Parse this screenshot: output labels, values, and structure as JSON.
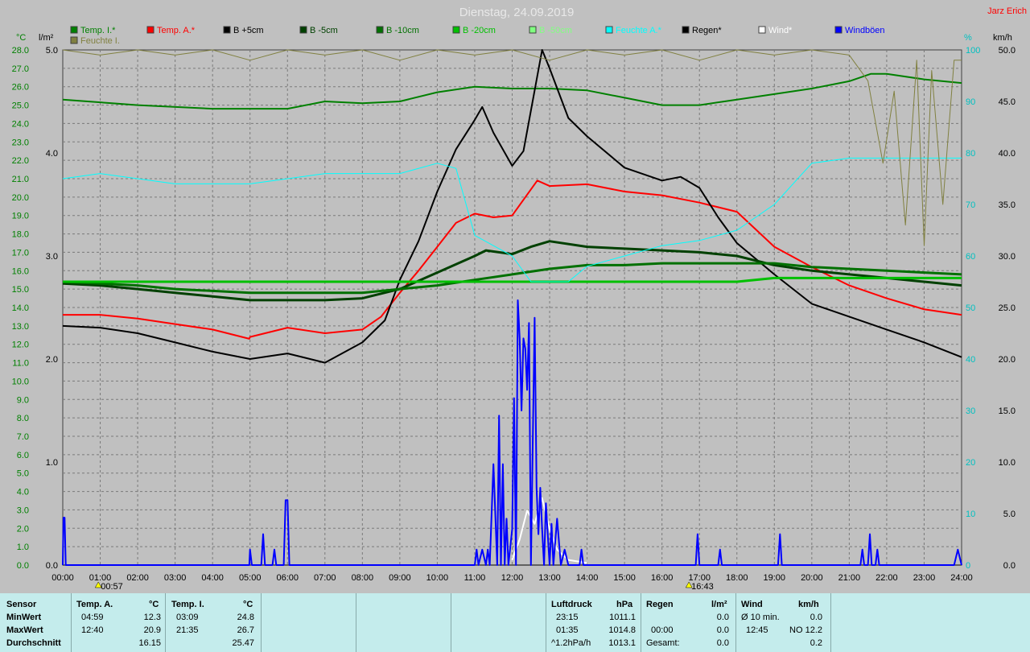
{
  "header": {
    "title": "Dienstag, 24.09.2019",
    "author": "Jarz Erich",
    "left_units": [
      "°C",
      "l/m²"
    ],
    "right_units": [
      "%",
      "km/h"
    ]
  },
  "legend": [
    {
      "label": "Temp. I.*",
      "color": "#008000"
    },
    {
      "label": "Temp. A.*",
      "color": "#ff0000"
    },
    {
      "label": "B +5cm",
      "color": "#000000"
    },
    {
      "label": "B -5cm",
      "color": "#004000"
    },
    {
      "label": "B -10cm",
      "color": "#007000"
    },
    {
      "label": "B -20cm",
      "color": "#00c000"
    },
    {
      "label": "B -50cm",
      "color": "#80ff80"
    },
    {
      "label": "Feuchte A.*",
      "color": "#00ffff"
    },
    {
      "label": "Regen*",
      "color": "#000000"
    },
    {
      "label": "Wind*",
      "color": "#ffffff"
    },
    {
      "label": "Windböen",
      "color": "#0000ff"
    },
    {
      "label": "Feuchte I.",
      "color": "#808040"
    }
  ],
  "chart_data": {
    "type": "line",
    "title": "Dienstag, 24.09.2019",
    "x_range": [
      0,
      24
    ],
    "x_ticks": [
      "00:00",
      "01:00",
      "02:00",
      "03:00",
      "04:00",
      "05:00",
      "06:00",
      "07:00",
      "08:00",
      "09:00",
      "10:00",
      "11:00",
      "12:00",
      "13:00",
      "14:00",
      "15:00",
      "16:00",
      "17:00",
      "18:00",
      "19:00",
      "20:00",
      "21:00",
      "22:00",
      "23:00",
      "24:00"
    ],
    "axes": {
      "temp_c": {
        "range": [
          0,
          28
        ],
        "ticks": [
          "0.0",
          "1.0",
          "2.0",
          "3.0",
          "4.0",
          "5.0",
          "6.0",
          "7.0",
          "8.0",
          "9.0",
          "10.0",
          "11.0",
          "12.0",
          "13.0",
          "14.0",
          "15.0",
          "16.0",
          "17.0",
          "18.0",
          "19.0",
          "20.0",
          "21.0",
          "22.0",
          "23.0",
          "24.0",
          "25.0",
          "26.0",
          "27.0",
          "28.0"
        ]
      },
      "rain_lm2": {
        "range": [
          0,
          5
        ],
        "ticks": [
          "0.0",
          "1.0",
          "2.0",
          "3.0",
          "4.0",
          "5.0"
        ]
      },
      "humidity_pct": {
        "range": [
          0,
          100
        ],
        "ticks": [
          "0",
          "10",
          "20",
          "30",
          "40",
          "50",
          "60",
          "70",
          "80",
          "90",
          "100"
        ]
      },
      "wind_kmh": {
        "range": [
          0,
          50
        ],
        "ticks": [
          "0.0",
          "5.0",
          "10.0",
          "15.0",
          "20.0",
          "25.0",
          "30.0",
          "35.0",
          "40.0",
          "45.0",
          "50.0"
        ]
      }
    },
    "markers": [
      {
        "label": "00:57",
        "x": 0.95
      },
      {
        "label": "16:43",
        "x": 16.72
      }
    ],
    "grid": true,
    "legend_position": "top",
    "series": [
      {
        "name": "Temp. I.*",
        "axis": "temp_c",
        "color": "#008000",
        "width": 2,
        "x": [
          0,
          2,
          4,
          6,
          7,
          8,
          9,
          10,
          11,
          12,
          13,
          14,
          15,
          16,
          17,
          18,
          19,
          20,
          21,
          21.58,
          22,
          23,
          24
        ],
        "y": [
          25.3,
          25.0,
          24.8,
          24.8,
          25.2,
          25.1,
          25.2,
          25.7,
          26.0,
          25.9,
          25.9,
          25.8,
          25.4,
          25.0,
          25.0,
          25.3,
          25.6,
          25.9,
          26.3,
          26.7,
          26.7,
          26.4,
          26.2
        ]
      },
      {
        "name": "Temp. A.*",
        "axis": "temp_c",
        "color": "#ff0000",
        "width": 2,
        "x": [
          0,
          1,
          2,
          3,
          4,
          4.98,
          5,
          6,
          7,
          8,
          8.5,
          9,
          9.5,
          10,
          10.5,
          11,
          11.5,
          12,
          12.67,
          13,
          14,
          15,
          16,
          17,
          18,
          19,
          20,
          21,
          22,
          23,
          24
        ],
        "y": [
          13.6,
          13.6,
          13.4,
          13.1,
          12.8,
          12.3,
          12.4,
          12.9,
          12.6,
          12.8,
          13.5,
          14.8,
          16.0,
          17.3,
          18.6,
          19.1,
          18.9,
          19.0,
          20.9,
          20.6,
          20.7,
          20.3,
          20.1,
          19.7,
          19.2,
          17.3,
          16.2,
          15.2,
          14.5,
          13.9,
          13.6
        ]
      },
      {
        "name": "B +5cm",
        "axis": "temp_c",
        "color": "#000000",
        "width": 2,
        "x": [
          0,
          1,
          2,
          3,
          4,
          5,
          6,
          7,
          8,
          8.6,
          9,
          9.5,
          10,
          10.5,
          11,
          11.2,
          11.5,
          12,
          12.3,
          12.8,
          13,
          13.5,
          14,
          15,
          16,
          16.5,
          17,
          17.5,
          18,
          19,
          20,
          21,
          22,
          23,
          24
        ],
        "y": [
          13.0,
          12.9,
          12.6,
          12.1,
          11.6,
          11.2,
          11.5,
          11.0,
          12.1,
          13.3,
          15.5,
          17.6,
          20.3,
          22.6,
          24.2,
          24.9,
          23.5,
          21.7,
          22.5,
          28.0,
          27.0,
          24.3,
          23.3,
          21.6,
          20.9,
          21.1,
          20.5,
          18.9,
          17.5,
          15.8,
          14.2,
          13.5,
          12.8,
          12.1,
          11.3
        ]
      },
      {
        "name": "B -5cm",
        "axis": "temp_c",
        "color": "#004000",
        "width": 3,
        "x": [
          0,
          1,
          2,
          3,
          4,
          5,
          6,
          7,
          8,
          9,
          10,
          11,
          11.3,
          12,
          12.5,
          13,
          14,
          15,
          16,
          17,
          18,
          19,
          20,
          21,
          22,
          23,
          24
        ],
        "y": [
          15.3,
          15.2,
          15.0,
          14.8,
          14.6,
          14.4,
          14.4,
          14.4,
          14.5,
          15.0,
          15.9,
          16.8,
          17.1,
          16.9,
          17.3,
          17.6,
          17.3,
          17.2,
          17.1,
          17.0,
          16.8,
          16.3,
          16.0,
          15.8,
          15.6,
          15.4,
          15.2
        ]
      },
      {
        "name": "B -10cm",
        "axis": "temp_c",
        "color": "#007000",
        "width": 3,
        "x": [
          0,
          1,
          2,
          3,
          4,
          5,
          6,
          7,
          8,
          9,
          10,
          11,
          12,
          13,
          14,
          15,
          16,
          17,
          18,
          19,
          20,
          21,
          22,
          23,
          24
        ],
        "y": [
          15.4,
          15.3,
          15.2,
          15.0,
          14.9,
          14.8,
          14.8,
          14.8,
          14.8,
          15.0,
          15.2,
          15.5,
          15.8,
          16.1,
          16.3,
          16.3,
          16.4,
          16.4,
          16.4,
          16.4,
          16.2,
          16.1,
          16.0,
          15.9,
          15.8
        ]
      },
      {
        "name": "B -20cm",
        "axis": "temp_c",
        "color": "#00c000",
        "width": 3,
        "x": [
          0,
          2,
          4,
          6,
          8,
          10,
          12,
          14,
          16,
          18,
          19,
          20,
          22,
          24
        ],
        "y": [
          15.4,
          15.4,
          15.4,
          15.4,
          15.4,
          15.4,
          15.4,
          15.4,
          15.4,
          15.4,
          15.6,
          15.6,
          15.6,
          15.6
        ]
      },
      {
        "name": "Feuchte A.*",
        "axis": "humidity_pct",
        "color": "#00ffff",
        "width": 1,
        "x": [
          0,
          1,
          2,
          3,
          4,
          5,
          6,
          7,
          8,
          9,
          10,
          10.5,
          11,
          12,
          12.5,
          13,
          13.5,
          14,
          15,
          16,
          17,
          18,
          19,
          20,
          21,
          22,
          23,
          24
        ],
        "y": [
          75,
          76,
          75,
          74,
          74,
          74,
          75,
          76,
          76,
          76,
          78,
          77,
          64,
          60,
          55,
          55,
          55,
          58,
          60,
          62,
          63,
          65,
          70,
          78,
          79,
          79,
          79,
          79
        ]
      },
      {
        "name": "Feuchte I.",
        "axis": "humidity_pct",
        "color": "#808040",
        "width": 1,
        "x": [
          0,
          1,
          2,
          3,
          4,
          5,
          6,
          7,
          8,
          9,
          10,
          11,
          12,
          13,
          14,
          15,
          16,
          17,
          18,
          19,
          20,
          21,
          21.5,
          21.9,
          22.2,
          22.5,
          22.8,
          23,
          23.2,
          23.5,
          23.8,
          24
        ],
        "y": [
          100,
          99,
          100,
          99,
          100,
          98,
          100,
          99,
          100,
          98,
          100,
          99,
          100,
          98,
          100,
          99,
          100,
          98,
          100,
          99,
          100,
          99,
          94,
          78,
          92,
          66,
          98,
          62,
          96,
          70,
          98,
          98
        ]
      },
      {
        "name": "Regen*",
        "axis": "rain_lm2",
        "color": "#000000",
        "width": 1,
        "x": [
          0,
          24
        ],
        "y": [
          0,
          0
        ]
      },
      {
        "name": "Wind*",
        "axis": "wind_kmh",
        "color": "#ffffff",
        "width": 2,
        "x": [
          12.0,
          12.2,
          12.4,
          12.6,
          12.8,
          13.0,
          13.2,
          13.5,
          14.0
        ],
        "y": [
          0.5,
          2.5,
          5.3,
          4.0,
          6.5,
          3.5,
          1.5,
          0.5,
          0.2
        ]
      },
      {
        "name": "Windböen",
        "axis": "wind_kmh",
        "color": "#0000ff",
        "width": 2,
        "x": [
          0,
          0.02,
          0.05,
          0.08,
          1,
          4.98,
          5,
          5.05,
          5.1,
          5.3,
          5.35,
          5.4,
          5.6,
          5.65,
          5.7,
          5.9,
          5.95,
          6.0,
          6.05,
          11,
          11.05,
          11.1,
          11.2,
          11.3,
          11.35,
          11.4,
          11.5,
          11.6,
          11.65,
          11.7,
          11.75,
          11.8,
          11.85,
          11.9,
          12.0,
          12.05,
          12.1,
          12.15,
          12.2,
          12.25,
          12.3,
          12.35,
          12.4,
          12.45,
          12.5,
          12.6,
          12.65,
          12.7,
          12.75,
          12.8,
          12.85,
          12.9,
          12.95,
          13.0,
          13.05,
          13.1,
          13.2,
          13.3,
          13.4,
          13.5,
          13.6,
          13.8,
          13.85,
          13.9,
          16.9,
          16.95,
          17.0,
          17.2,
          17.5,
          17.55,
          17.6,
          19.1,
          19.15,
          19.2,
          21.3,
          21.35,
          21.4,
          21.5,
          21.55,
          21.6,
          21.7,
          21.75,
          21.8,
          23.8,
          23.9,
          24
        ],
        "y": [
          0,
          4.6,
          4.6,
          0,
          0,
          0,
          1.5,
          0,
          0,
          0,
          3.0,
          0,
          0,
          1.5,
          0,
          0,
          6.3,
          6.3,
          0,
          0,
          1.5,
          0,
          1.5,
          0,
          1.5,
          0,
          9.8,
          0,
          14.5,
          0,
          9.8,
          0,
          4.5,
          0,
          3.5,
          16.2,
          0,
          25.7,
          22.0,
          15.0,
          22.0,
          21.0,
          17.0,
          23.5,
          0,
          24.0,
          7.5,
          3.0,
          7.5,
          3.5,
          0,
          6.0,
          3.0,
          0,
          4.0,
          0,
          4.5,
          0,
          1.5,
          0,
          0,
          0,
          1.5,
          0,
          0,
          3.0,
          0,
          0,
          0,
          1.5,
          0,
          0,
          3.0,
          0,
          0,
          1.5,
          0,
          0,
          3.0,
          0,
          0,
          1.5,
          0,
          0,
          1.5,
          0
        ]
      }
    ]
  },
  "stats": {
    "sensor": {
      "label": "Sensor",
      "min": "MinWert",
      "max": "MaxWert",
      "avg": "Durchschnitt"
    },
    "temp_a": {
      "label": "Temp. A.",
      "unit": "°C",
      "min_time": "04:59",
      "min_val": "12.3",
      "max_time": "12:40",
      "max_val": "20.9",
      "avg": "16.15"
    },
    "temp_i": {
      "label": "Temp. I.",
      "unit": "°C",
      "min_time": "03:09",
      "min_val": "24.8",
      "max_time": "21:35",
      "max_val": "26.7",
      "avg": "25.47"
    },
    "pressure": {
      "label": "Luftdruck",
      "unit": "hPa",
      "min_time": "23:15",
      "min_val": "1011.1",
      "max_time": "01:35",
      "max_val": "1014.8",
      "trend": "^1.2hPa/h",
      "avg": "1013.1"
    },
    "rain": {
      "label": "Regen",
      "unit": "l/m²",
      "r1_time": "00:00",
      "r1_val": "0.0",
      "total_label": "Gesamt:",
      "total_val": "0.0",
      "top_val": "0.0"
    },
    "wind": {
      "label": "Wind",
      "unit": "km/h",
      "avg_label": "Ø 10 min.",
      "avg_val": "0.0",
      "gust_time": "12:45",
      "gust_val": "NO 12.2",
      "total_val": "0.2"
    }
  }
}
